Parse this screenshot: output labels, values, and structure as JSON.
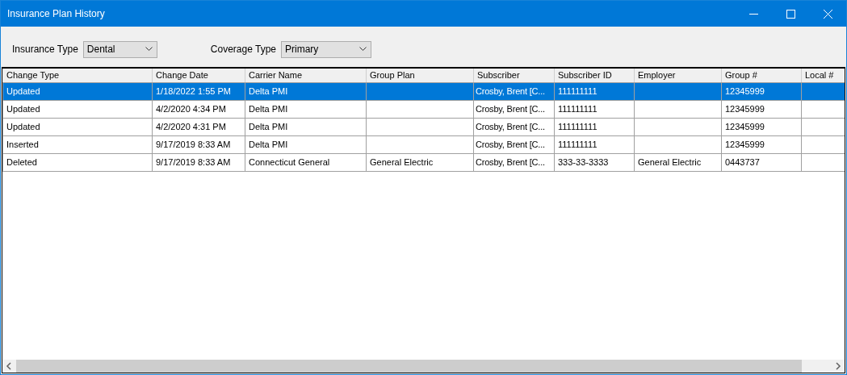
{
  "window": {
    "title": "Insurance Plan History"
  },
  "filters": [
    {
      "label": "Insurance Type",
      "value": "Dental"
    },
    {
      "label": "Coverage Type",
      "value": "Primary"
    }
  ],
  "table": {
    "columns": [
      "Change Type",
      "Change Date",
      "Carrier Name",
      "Group Plan",
      "Subscriber",
      "Subscriber ID",
      "Employer",
      "Group #",
      "Local #"
    ],
    "rows": [
      {
        "selected": true,
        "cells": [
          "Updated",
          "1/18/2022 1:55 PM",
          "Delta PMI",
          "",
          "Crosby, Brent [C...",
          "111111111",
          "",
          "12345999",
          ""
        ]
      },
      {
        "selected": false,
        "cells": [
          "Updated",
          "4/2/2020 4:34 PM",
          "Delta PMI",
          "",
          "Crosby, Brent [C...",
          "111111111",
          "",
          "12345999",
          ""
        ]
      },
      {
        "selected": false,
        "cells": [
          "Updated",
          "4/2/2020 4:31 PM",
          "Delta PMI",
          "",
          "Crosby, Brent [C...",
          "111111111",
          "",
          "12345999",
          ""
        ]
      },
      {
        "selected": false,
        "cells": [
          "Inserted",
          "9/17/2019 8:33 AM",
          "Delta PMI",
          "",
          "Crosby, Brent [C...",
          "111111111",
          "",
          "12345999",
          ""
        ]
      },
      {
        "selected": false,
        "cells": [
          "Deleted",
          "9/17/2019 8:33 AM",
          "Connecticut General",
          "General Electric",
          "Crosby, Brent [C...",
          "333-33-3333",
          "General Electric",
          "0443737",
          ""
        ]
      }
    ]
  }
}
